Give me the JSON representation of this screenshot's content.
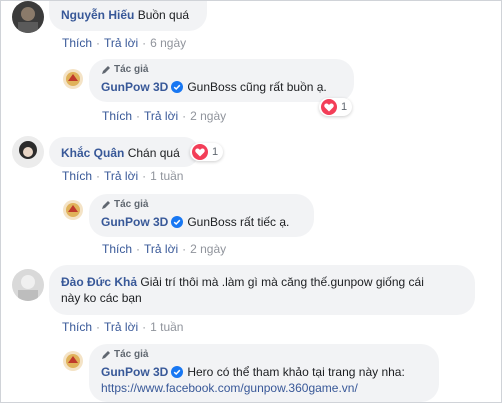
{
  "actions": {
    "like": "Thích",
    "reply": "Trả lời",
    "separator": "·"
  },
  "author_badge": "Tác giả",
  "comments": [
    {
      "name": "Nguyễn Hiếu",
      "text": "Buồn quá",
      "time": "6 ngày",
      "reply": {
        "name": "GunPow 3D",
        "text": "GunBoss cũng rất buồn ạ.",
        "time": "2 ngày",
        "reaction_count": "1"
      }
    },
    {
      "name": "Khắc Quân",
      "text": "Chán quá",
      "time": "1 tuần",
      "reaction_count": "1",
      "reply": {
        "name": "GunPow 3D",
        "text": "GunBoss rất tiếc ạ.",
        "time": "2 ngày"
      }
    },
    {
      "name": "Đào Đức Khả",
      "text_line1": "Giải trí thôi mà .làm gì mà căng thế.gunpow giống cái",
      "text_line2": "này ko các bạn",
      "time": "1 tuần",
      "reply": {
        "name": "GunPow 3D",
        "text": "Hero có thể tham khảo tại trang này nha:",
        "link": "https://www.facebook.com/gunpow.360game.vn/"
      }
    }
  ],
  "colors": {
    "link": "#385898",
    "bubble": "#f2f3f5",
    "heart": "#f33e58",
    "verified": "#1877f2"
  }
}
